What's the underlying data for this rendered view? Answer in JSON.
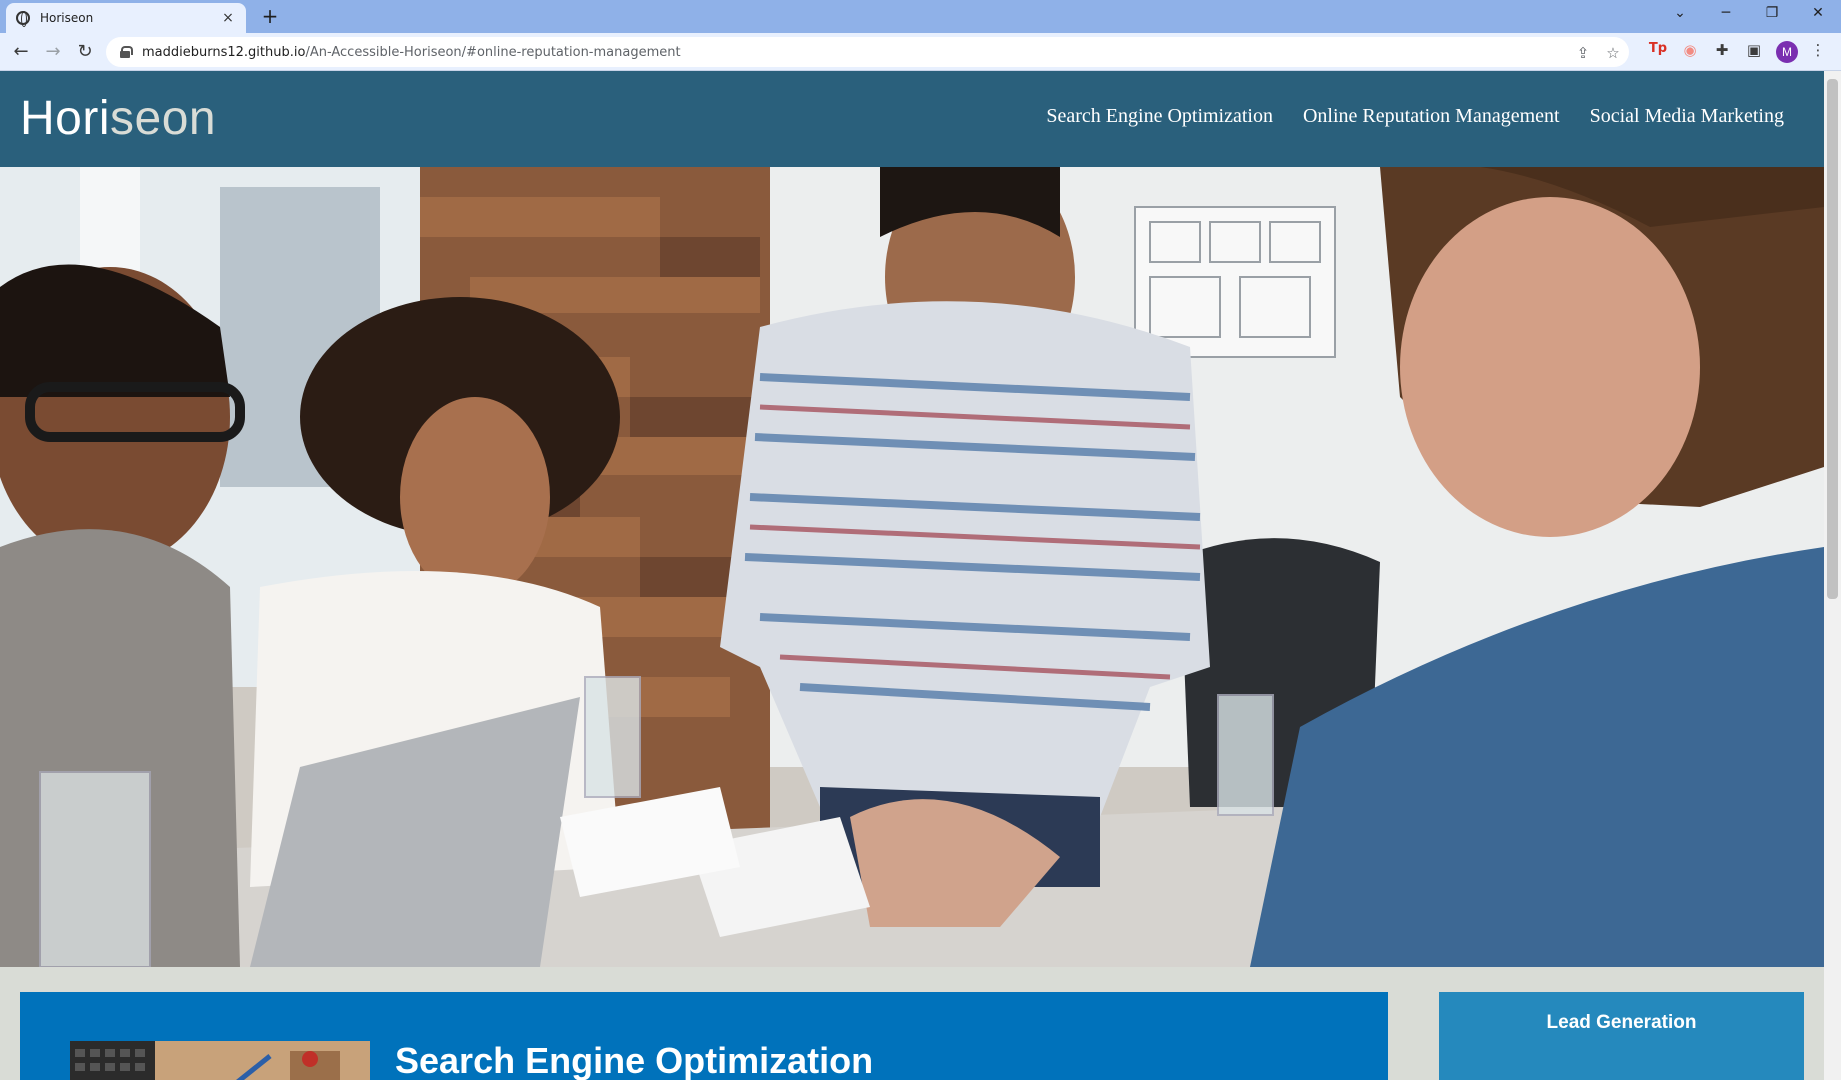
{
  "browser": {
    "tab_title": "Horiseon",
    "tab_close": "×",
    "new_tab": "+",
    "url_host": "maddieburns12.github.io",
    "url_path": "/An-Accessible-Horiseon/#online-reputation-management",
    "avatar_letter": "M",
    "accent": "#8fb1e8"
  },
  "site": {
    "logo_main": "Hori",
    "logo_accent": "seon",
    "nav": [
      "Search Engine Optimization",
      "Online Reputation Management",
      "Social Media Marketing"
    ],
    "header_color": "#2a607c"
  },
  "content": {
    "card_title": "Search Engine Optimization",
    "sidebar_title": "Lead Generation"
  }
}
